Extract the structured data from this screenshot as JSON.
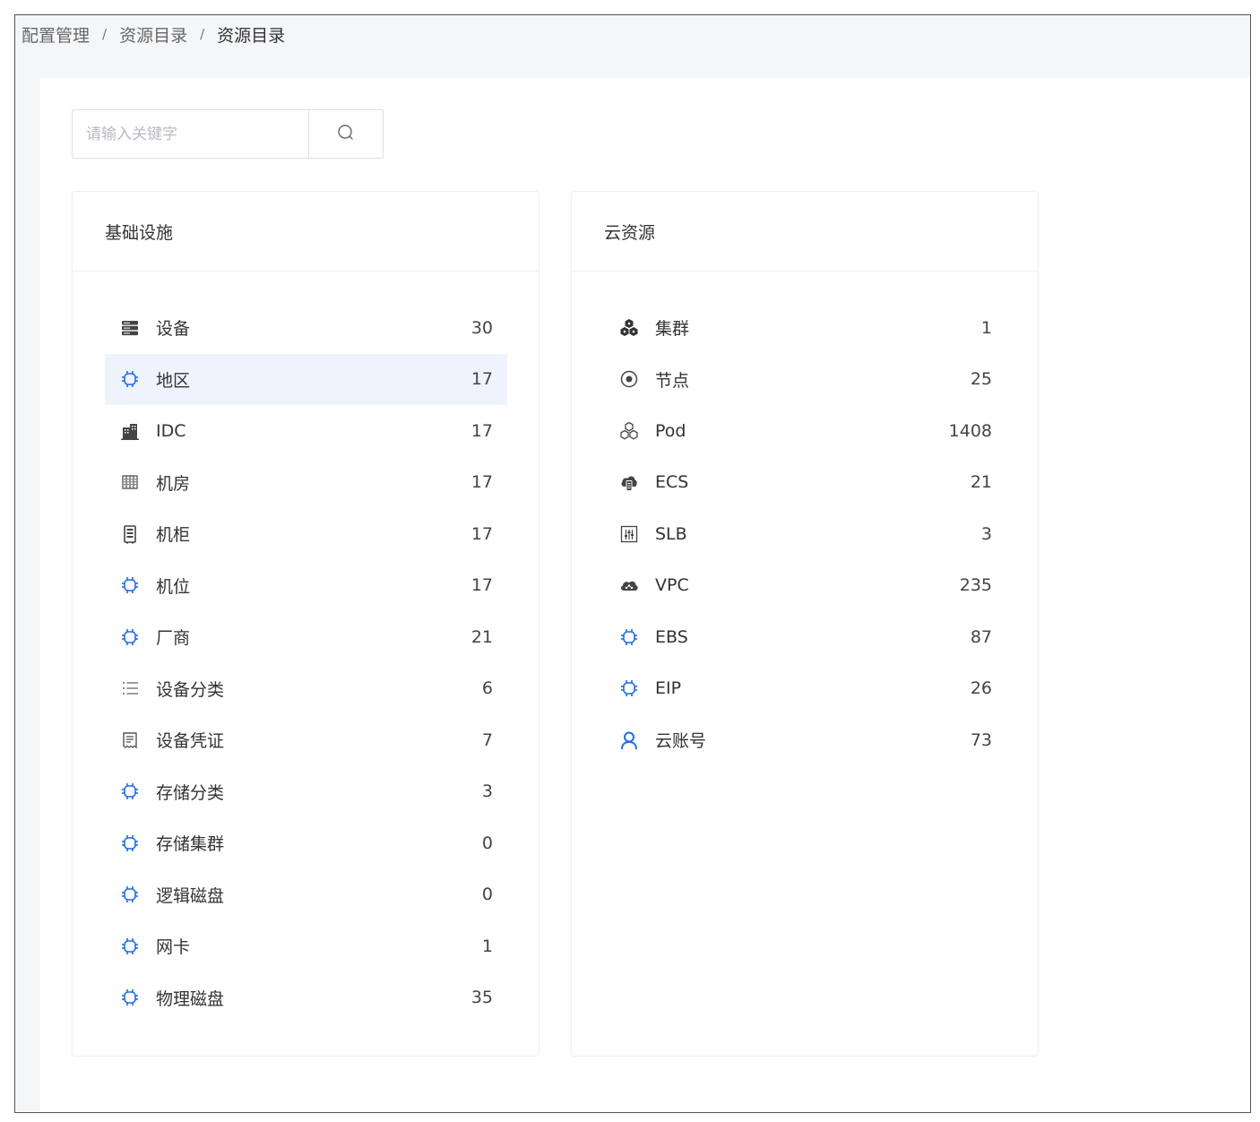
{
  "breadcrumb": [
    "配置管理",
    "资源目录",
    "资源目录"
  ],
  "breadcrumb_separator": "/",
  "search": {
    "placeholder": "请输入关键字",
    "value": ""
  },
  "cards": [
    {
      "title": "基础设施",
      "items": [
        {
          "label": "设备",
          "count": "30",
          "icon": "server-icon"
        },
        {
          "label": "地区",
          "count": "17",
          "icon": "chip-icon",
          "active": true
        },
        {
          "label": "IDC",
          "count": "17",
          "icon": "building-icon"
        },
        {
          "label": "机房",
          "count": "17",
          "icon": "grid-room-icon"
        },
        {
          "label": "机柜",
          "count": "17",
          "icon": "cabinet-icon"
        },
        {
          "label": "机位",
          "count": "17",
          "icon": "chip-icon"
        },
        {
          "label": "厂商",
          "count": "21",
          "icon": "chip-icon"
        },
        {
          "label": "设备分类",
          "count": "6",
          "icon": "list-icon"
        },
        {
          "label": "设备凭证",
          "count": "7",
          "icon": "receipt-icon"
        },
        {
          "label": "存储分类",
          "count": "3",
          "icon": "chip-icon"
        },
        {
          "label": "存储集群",
          "count": "0",
          "icon": "chip-icon"
        },
        {
          "label": "逻辑磁盘",
          "count": "0",
          "icon": "chip-icon"
        },
        {
          "label": "网卡",
          "count": "1",
          "icon": "chip-icon"
        },
        {
          "label": "物理磁盘",
          "count": "35",
          "icon": "chip-icon"
        }
      ]
    },
    {
      "title": "云资源",
      "items": [
        {
          "label": "集群",
          "count": "1",
          "icon": "cluster-icon"
        },
        {
          "label": "节点",
          "count": "25",
          "icon": "node-icon"
        },
        {
          "label": "Pod",
          "count": "1408",
          "icon": "pod-icon"
        },
        {
          "label": "ECS",
          "count": "21",
          "icon": "cloud-server-icon"
        },
        {
          "label": "SLB",
          "count": "3",
          "icon": "slider-box-icon"
        },
        {
          "label": "VPC",
          "count": "235",
          "icon": "cloud-network-icon"
        },
        {
          "label": "EBS",
          "count": "87",
          "icon": "chip-icon"
        },
        {
          "label": "EIP",
          "count": "26",
          "icon": "chip-icon"
        },
        {
          "label": "云账号",
          "count": "73",
          "icon": "user-icon"
        }
      ]
    }
  ],
  "colors": {
    "accent": "#1a6cf0",
    "active_bg": "#eef3fe",
    "icon_dark": "#444444"
  }
}
